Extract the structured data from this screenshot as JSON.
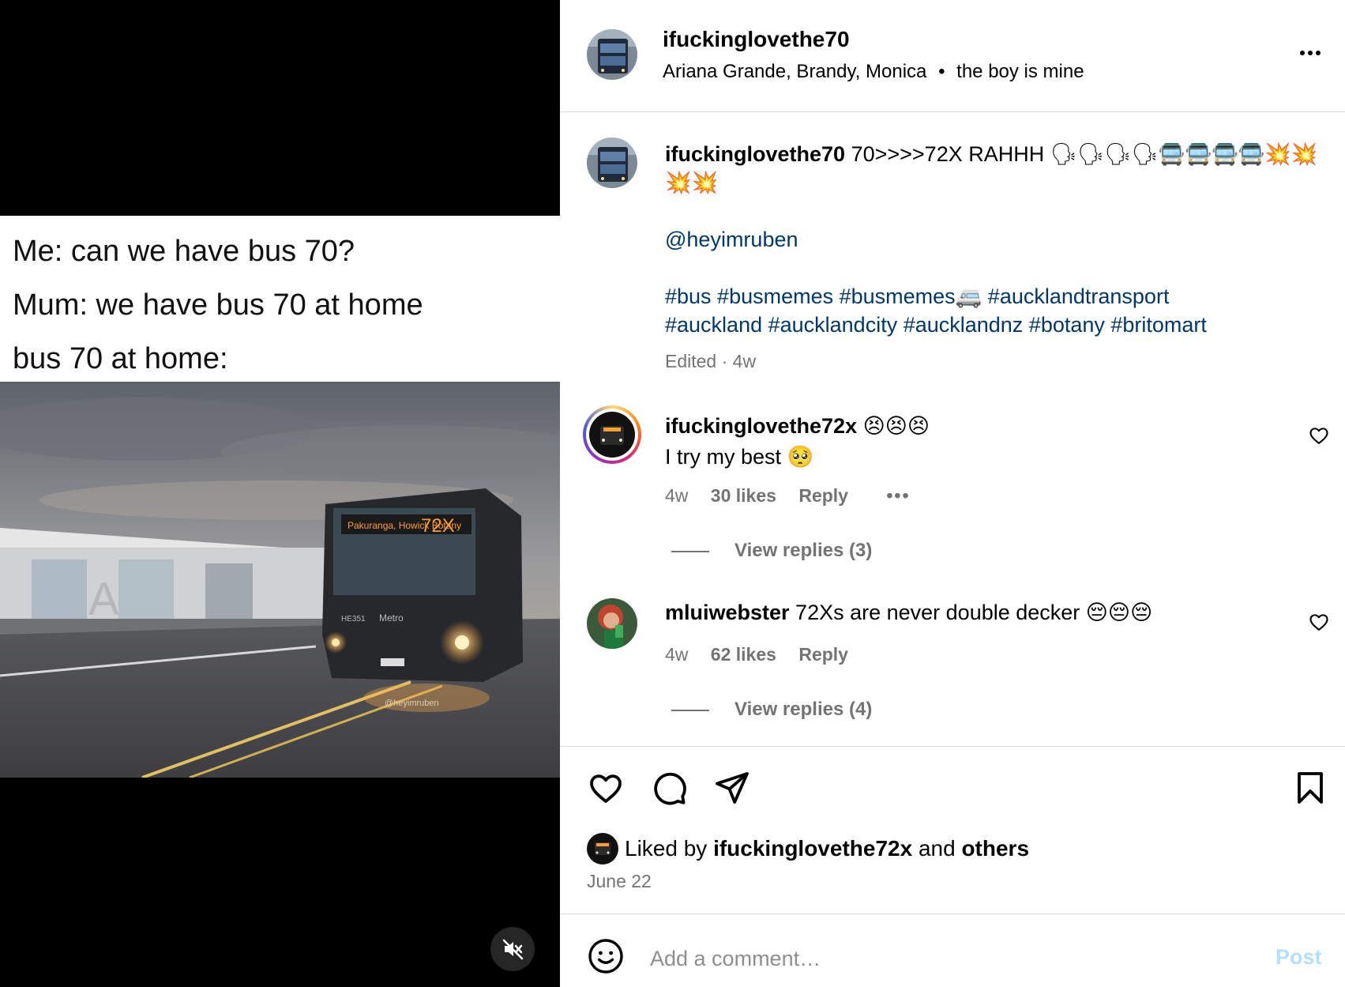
{
  "post": {
    "media": {
      "meme_lines": [
        "Me: can we have bus 70?",
        "Mum: we have bus 70 at home",
        "bus 70 at home:"
      ],
      "bus_sign_route": "72X",
      "bus_sign_dest": "Pakuranga, Howick Botany",
      "bus_fleet": "HE351",
      "bus_brand": "Metro",
      "watermark": "@heyimruben",
      "mute_icon": "muted-speaker-icon"
    },
    "header": {
      "username": "ifuckinglovethe70",
      "audio_artists": "Ariana Grande, Brandy, Monica",
      "audio_sep": "•",
      "audio_title": "the boy is mine",
      "more_icon": "more-options-icon"
    },
    "caption": {
      "username": "ifuckinglovethe70",
      "text": " 70>>>>72X RAHHH 🗣🗣🗣🗣🚍🚍🚍🚍💥💥💥💥",
      "mention": "@heyimruben",
      "hashtags_line1": "#bus #busmemes #busmemes🚐 #aucklandtransport",
      "hashtags_line2": "#auckland #aucklandcity #aucklandnz #botany #britomart",
      "edited": "Edited",
      "dot": "·",
      "time": "4w"
    },
    "comments": [
      {
        "username": "ifuckinglovethe72x",
        "emoji": " 😣😣😣",
        "text": "I try my best 🥺",
        "time": "4w",
        "likes": "30 likes",
        "reply": "Reply",
        "more": "•••",
        "view_replies": "View replies (3)"
      },
      {
        "username": "mluiwebster",
        "text": " 72Xs are never double decker 😔😔😔",
        "time": "4w",
        "likes": "62 likes",
        "reply": "Reply",
        "view_replies": "View replies (4)"
      }
    ],
    "actions": {
      "like_icon": "heart-icon",
      "comment_icon": "comment-icon",
      "share_icon": "share-icon",
      "save_icon": "bookmark-icon"
    },
    "liked_by": {
      "prefix": "Liked by ",
      "user": "ifuckinglovethe72x",
      "and": " and ",
      "others": "others"
    },
    "date": "June 22",
    "add_comment": {
      "placeholder": "Add a comment…",
      "post_label": "Post",
      "emoji_icon": "emoji-icon"
    },
    "colors": {
      "link": "#00376b",
      "muted": "#737373",
      "post_disabled": "#b2dffc",
      "divider": "#dbdbdb"
    }
  }
}
